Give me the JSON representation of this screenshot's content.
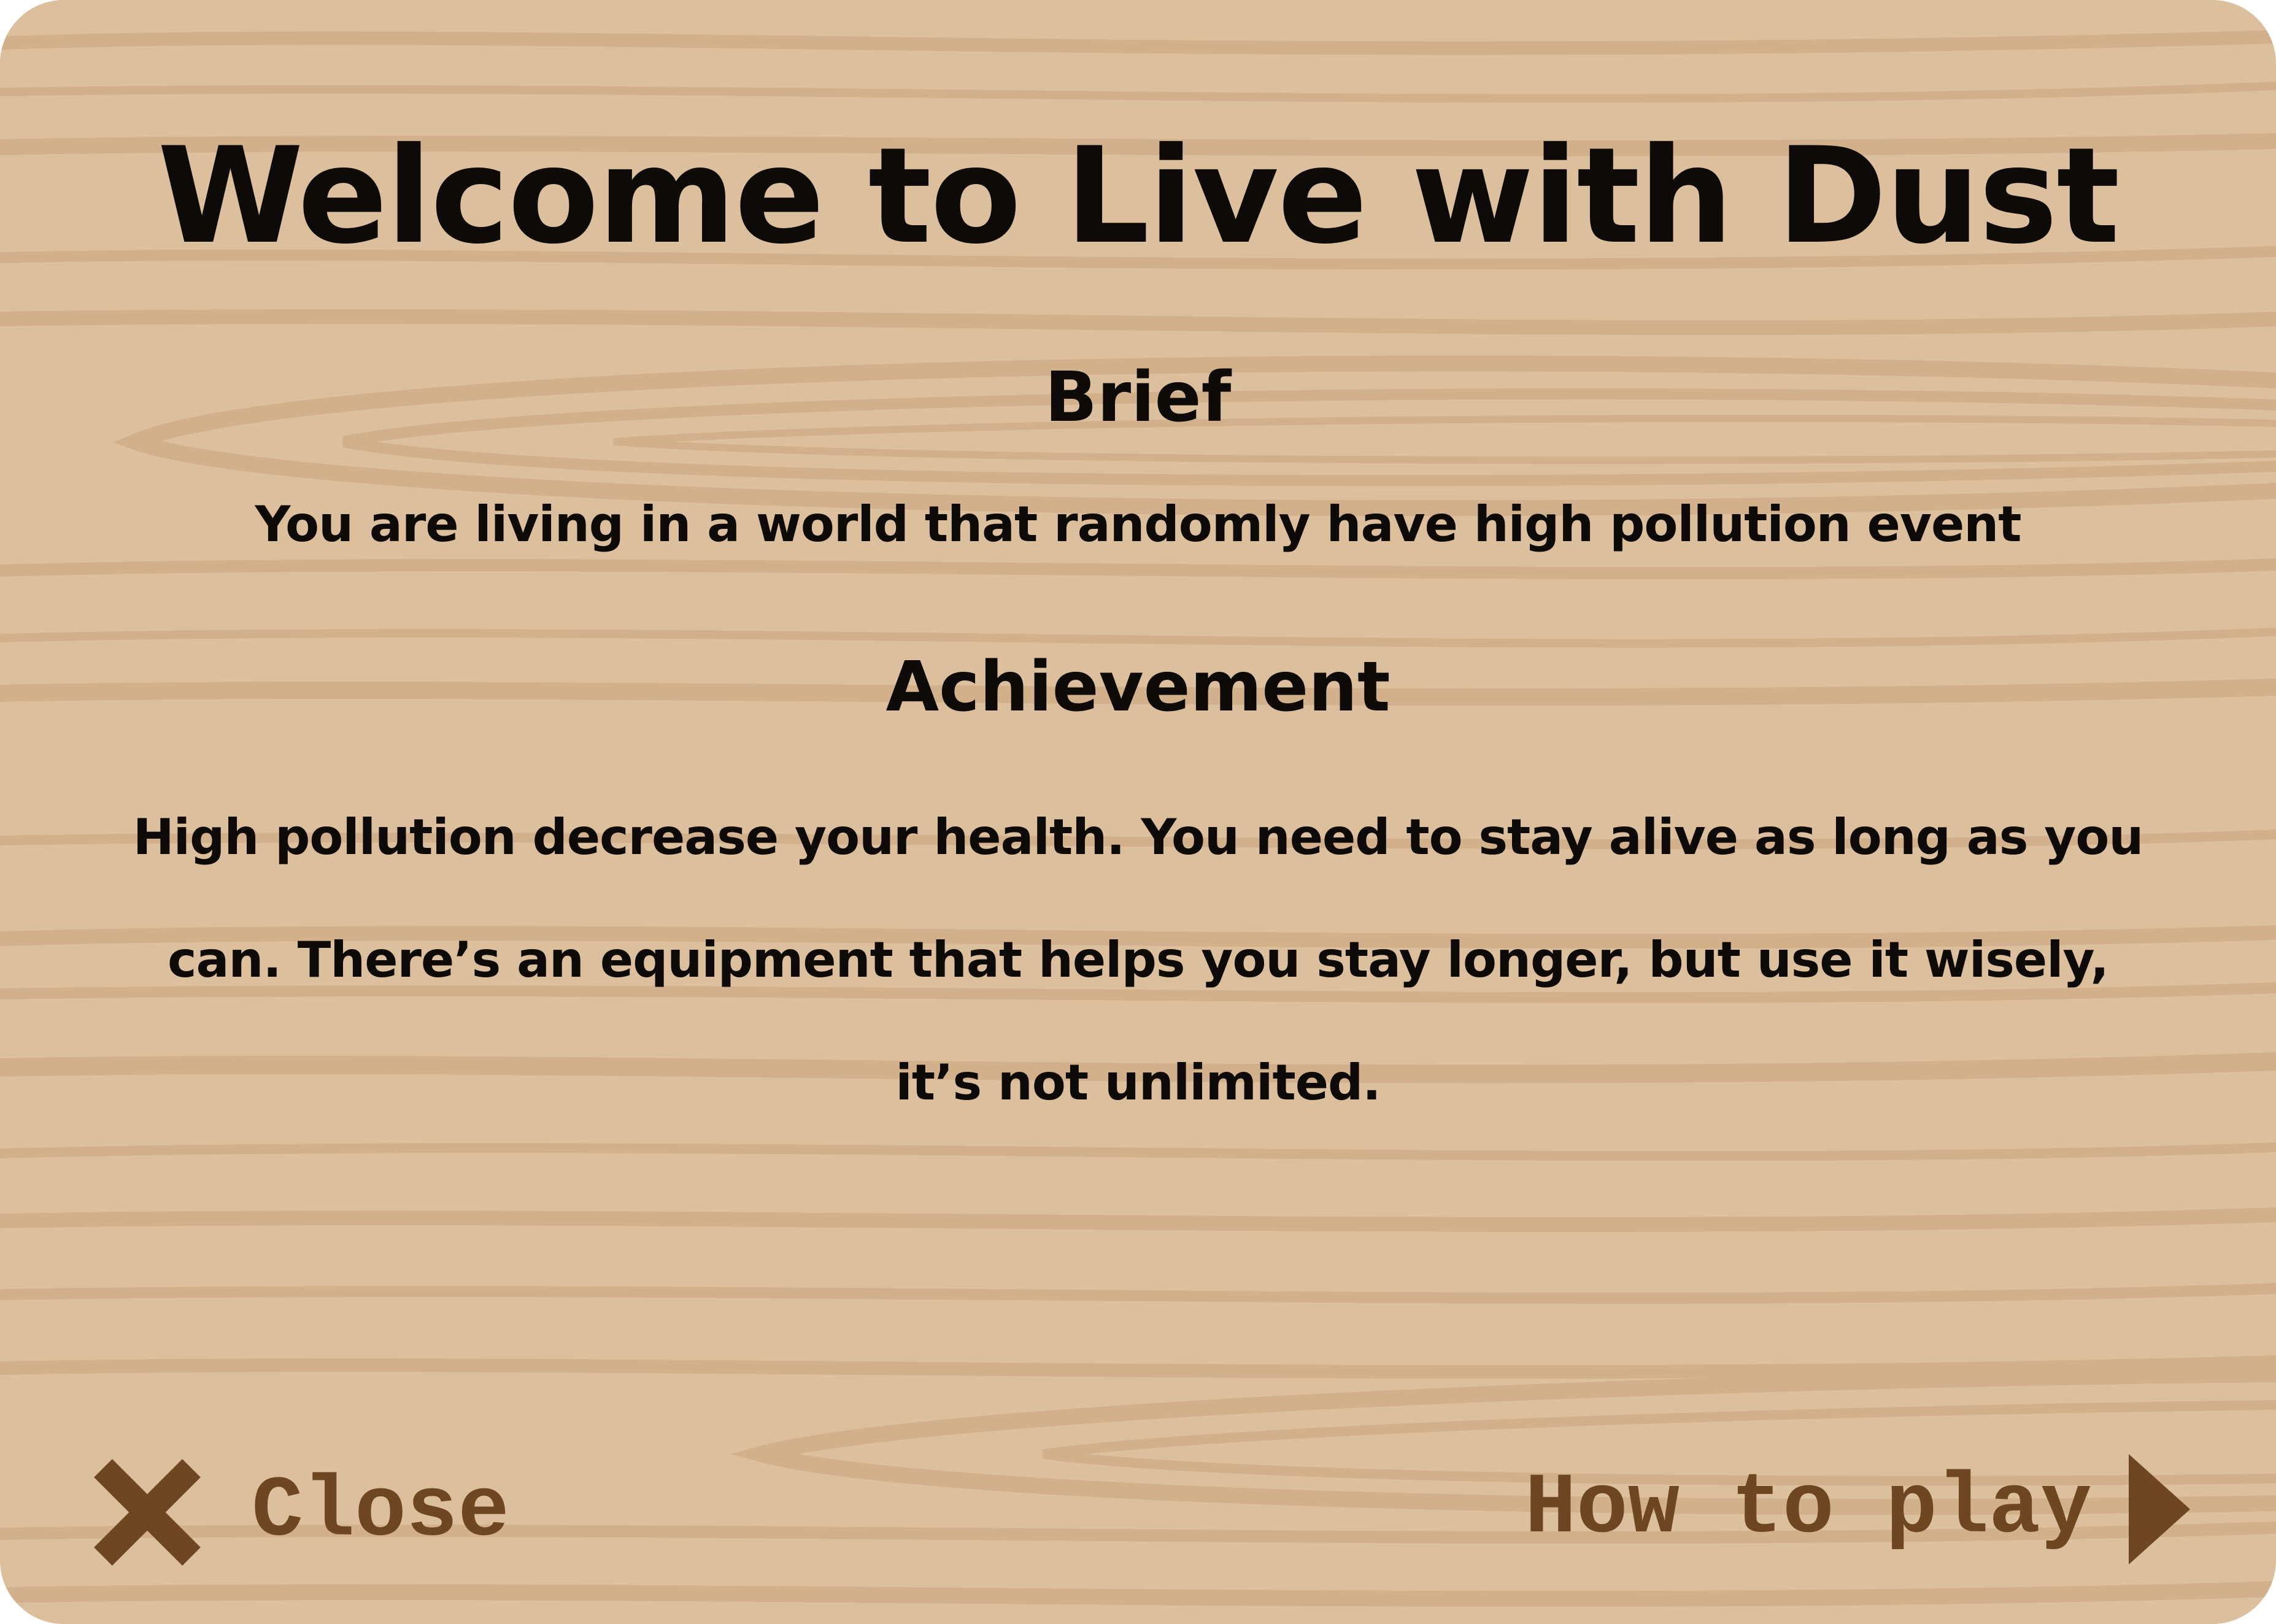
{
  "window": {
    "title": "Welcome to Live with Dust"
  },
  "brief": {
    "heading": "Brief",
    "text": "You are living in a world that randomly have high pollution event"
  },
  "achievement": {
    "heading": "Achievement",
    "text": "High pollution decrease your health. You need to stay alive as long as you can. There’s an equipment that helps you stay longer, but use it wisely, it’s not unlimited."
  },
  "buttons": {
    "close_label": "Close",
    "close_icon": "close-x-icon",
    "howto_label": "How to play",
    "howto_icon": "play-arrow-icon"
  },
  "colors": {
    "wood_base": "#dcc09d",
    "wood_grain": "#d2b08c",
    "text": "#0d0a07",
    "button": "#6e4621"
  }
}
